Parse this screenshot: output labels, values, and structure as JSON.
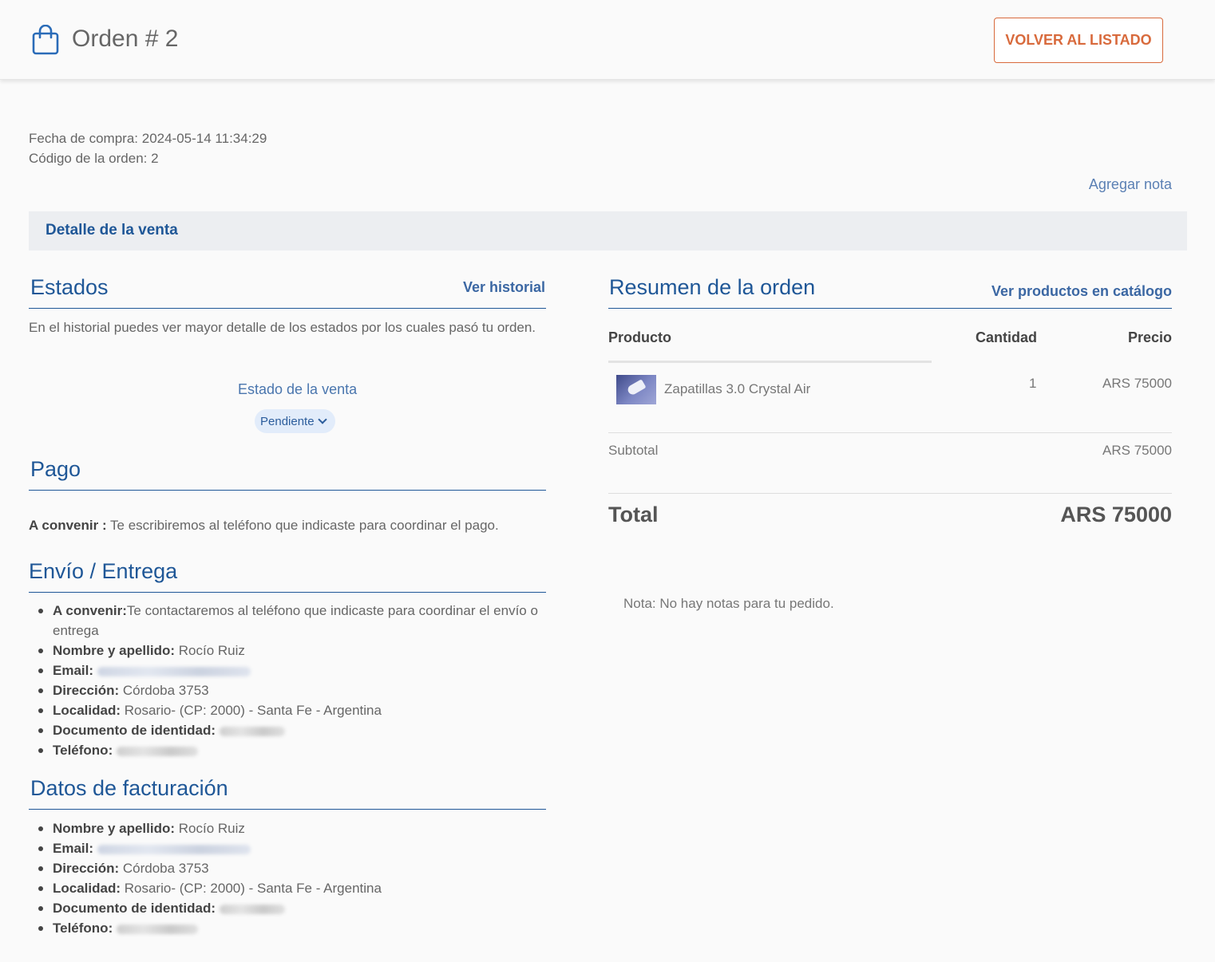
{
  "header": {
    "title": "Orden # 2",
    "back_button": "VOLVER AL LISTADO",
    "icon": "shopping-bag-icon"
  },
  "meta": {
    "purchase_date": "Fecha de compra: 2024-05-14 11:34:29",
    "order_code": "Código de la orden: 2",
    "add_note": "Agregar nota"
  },
  "band_title": "Detalle de la venta",
  "estados": {
    "title": "Estados",
    "history_link": "Ver historial",
    "description": "En el historial puedes ver mayor detalle de los estados por los cuales pasó tu orden.",
    "status_label": "Estado de la venta",
    "status_value": "Pendiente"
  },
  "pago": {
    "title": "Pago",
    "method_label": "A convenir :",
    "method_text": " Te escribiremos al teléfono que indicaste para coordinar el pago."
  },
  "envio": {
    "title": "Envío / Entrega",
    "delivery_label": "A convenir:",
    "delivery_text": "Te contactaremos al teléfono que indicaste para coordinar el envío o entrega",
    "name_label": "Nombre y apellido:",
    "name_value": " Rocío Ruiz",
    "email_label": "Email:",
    "address_label": "Dirección:",
    "address_value": " Córdoba 3753",
    "locality_label": "Localidad:",
    "locality_value": " Rosario- (CP: 2000) - Santa Fe - Argentina",
    "document_label": "Documento de identidad:",
    "phone_label": "Teléfono:"
  },
  "facturacion": {
    "title": "Datos de facturación",
    "name_label": "Nombre y apellido:",
    "name_value": " Rocío Ruiz",
    "email_label": "Email:",
    "address_label": "Dirección:",
    "address_value": " Córdoba 3753",
    "locality_label": "Localidad:",
    "locality_value": " Rosario- (CP: 2000) - Santa Fe - Argentina",
    "document_label": "Documento de identidad:",
    "phone_label": "Teléfono:"
  },
  "resumen": {
    "title": "Resumen de la orden",
    "catalog_link": "Ver productos en catálogo",
    "columns": {
      "product": "Producto",
      "quantity": "Cantidad",
      "price": "Precio"
    },
    "items": [
      {
        "name": "Zapatillas 3.0 Crystal Air",
        "quantity": "1",
        "price": "ARS 75000"
      }
    ],
    "subtotal_label": "Subtotal",
    "subtotal_value": "ARS 75000",
    "total_label": "Total",
    "total_value": "ARS 75000",
    "note": "Nota: No hay notas para tu pedido."
  },
  "colors": {
    "primary_blue": "#1f5797",
    "accent_orange": "#d86a3c",
    "band_bg": "#eceef1"
  }
}
